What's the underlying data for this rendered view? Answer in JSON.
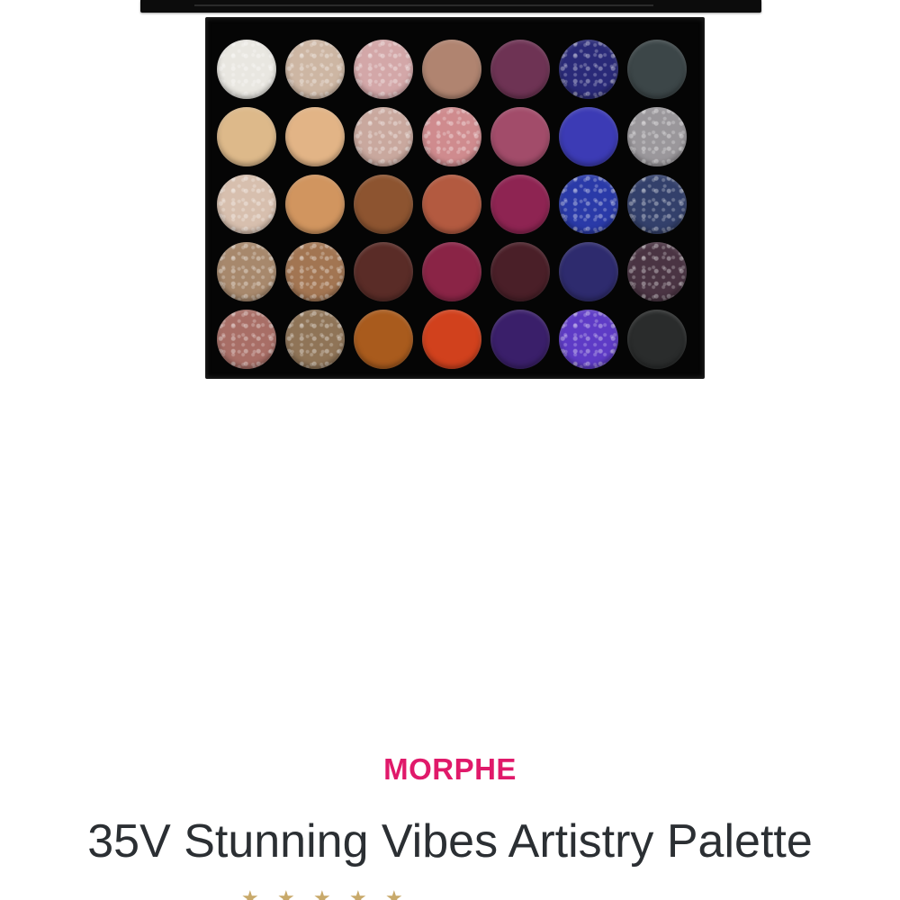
{
  "product": {
    "brand": "MORPHE",
    "title": "35V Stunning Vibes Artistry Palette",
    "brand_color": "#e0196a"
  },
  "rating": {
    "stars_icon": "star-icon",
    "star_color": "#c8a96a"
  },
  "palette": {
    "rows": [
      [
        {
          "color": "#e9e7e1",
          "finish": "shimmer"
        },
        {
          "color": "#cdb6a3",
          "finish": "shimmer"
        },
        {
          "color": "#d3a7a8",
          "finish": "shimmer"
        },
        {
          "color": "#b08470",
          "finish": "matte"
        },
        {
          "color": "#6e3354",
          "finish": "matte"
        },
        {
          "color": "#2a2a78",
          "finish": "shimmer"
        },
        {
          "color": "#3c4648",
          "finish": "matte"
        }
      ],
      [
        {
          "color": "#ddb98a",
          "finish": "matte"
        },
        {
          "color": "#e2b486",
          "finish": "matte"
        },
        {
          "color": "#c9a89e",
          "finish": "shimmer"
        },
        {
          "color": "#cf8b8e",
          "finish": "shimmer"
        },
        {
          "color": "#a24c6a",
          "finish": "matte"
        },
        {
          "color": "#3c3bb5",
          "finish": "matte"
        },
        {
          "color": "#9a979b",
          "finish": "shimmer"
        }
      ],
      [
        {
          "color": "#d7bfae",
          "finish": "shimmer"
        },
        {
          "color": "#d1955f",
          "finish": "matte"
        },
        {
          "color": "#8d5430",
          "finish": "matte"
        },
        {
          "color": "#b35a40",
          "finish": "matte"
        },
        {
          "color": "#8e2452",
          "finish": "matte"
        },
        {
          "color": "#2a3aa8",
          "finish": "shimmer"
        },
        {
          "color": "#33406b",
          "finish": "shimmer"
        }
      ],
      [
        {
          "color": "#a7886c",
          "finish": "shimmer"
        },
        {
          "color": "#a27552",
          "finish": "shimmer"
        },
        {
          "color": "#5a2c27",
          "finish": "matte"
        },
        {
          "color": "#8a2446",
          "finish": "matte"
        },
        {
          "color": "#4a1f28",
          "finish": "matte"
        },
        {
          "color": "#2e2b6e",
          "finish": "matte"
        },
        {
          "color": "#4a3443",
          "finish": "shimmer"
        }
      ],
      [
        {
          "color": "#a86e66",
          "finish": "shimmer"
        },
        {
          "color": "#8f7457",
          "finish": "shimmer"
        },
        {
          "color": "#a95b1d",
          "finish": "matte"
        },
        {
          "color": "#d1411d",
          "finish": "matte"
        },
        {
          "color": "#3a1f6a",
          "finish": "matte"
        },
        {
          "color": "#5e3bc6",
          "finish": "shimmer"
        },
        {
          "color": "#2a2c2c",
          "finish": "matte"
        }
      ]
    ]
  }
}
